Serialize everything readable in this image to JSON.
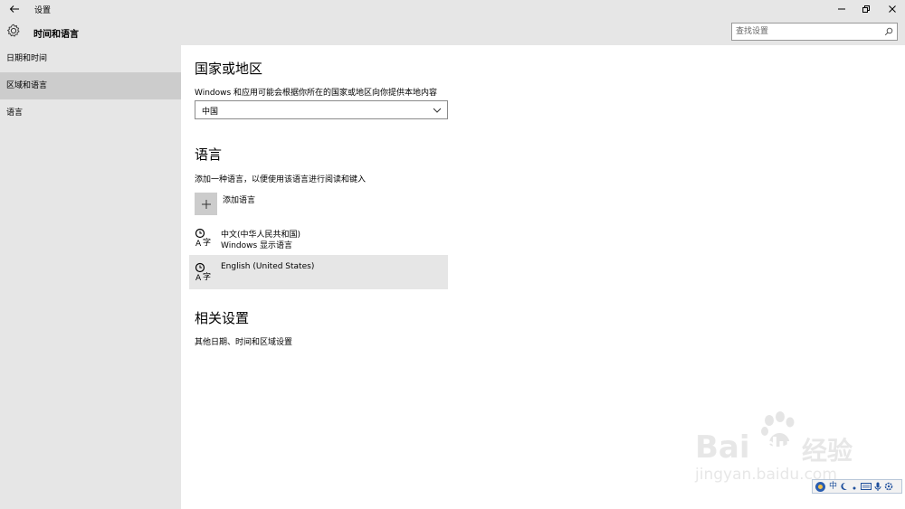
{
  "window": {
    "title": "设置"
  },
  "header": {
    "app_title": "时间和语言",
    "search_placeholder": "查找设置"
  },
  "sidebar": {
    "items": [
      {
        "label": "日期和时间",
        "active": false
      },
      {
        "label": "区域和语言",
        "active": true
      },
      {
        "label": "语言",
        "active": false
      }
    ]
  },
  "region": {
    "title": "国家或地区",
    "description": "Windows 和应用可能会根据你所在的国家或地区向你提供本地内容",
    "selected": "中国"
  },
  "language": {
    "title": "语言",
    "description": "添加一种语言，以便使用该语言进行阅读和键入",
    "add_label": "添加语言",
    "items": [
      {
        "name": "中文(中华人民共和国)",
        "sub": "Windows 显示语言",
        "selected": false
      },
      {
        "name": "English (United States)",
        "sub": "",
        "selected": true
      }
    ]
  },
  "related": {
    "title": "相关设置",
    "link": "其他日期、时间和区域设置"
  },
  "watermark": {
    "brand": "Bai",
    "brand2": "du",
    "cn": "经验",
    "url": "jingyan.baidu.com"
  },
  "ime": {
    "mode": "中"
  },
  "colors": {
    "chrome": "#e6e6e6",
    "active": "#cccccc",
    "selected_row": "#e6e6e6"
  }
}
